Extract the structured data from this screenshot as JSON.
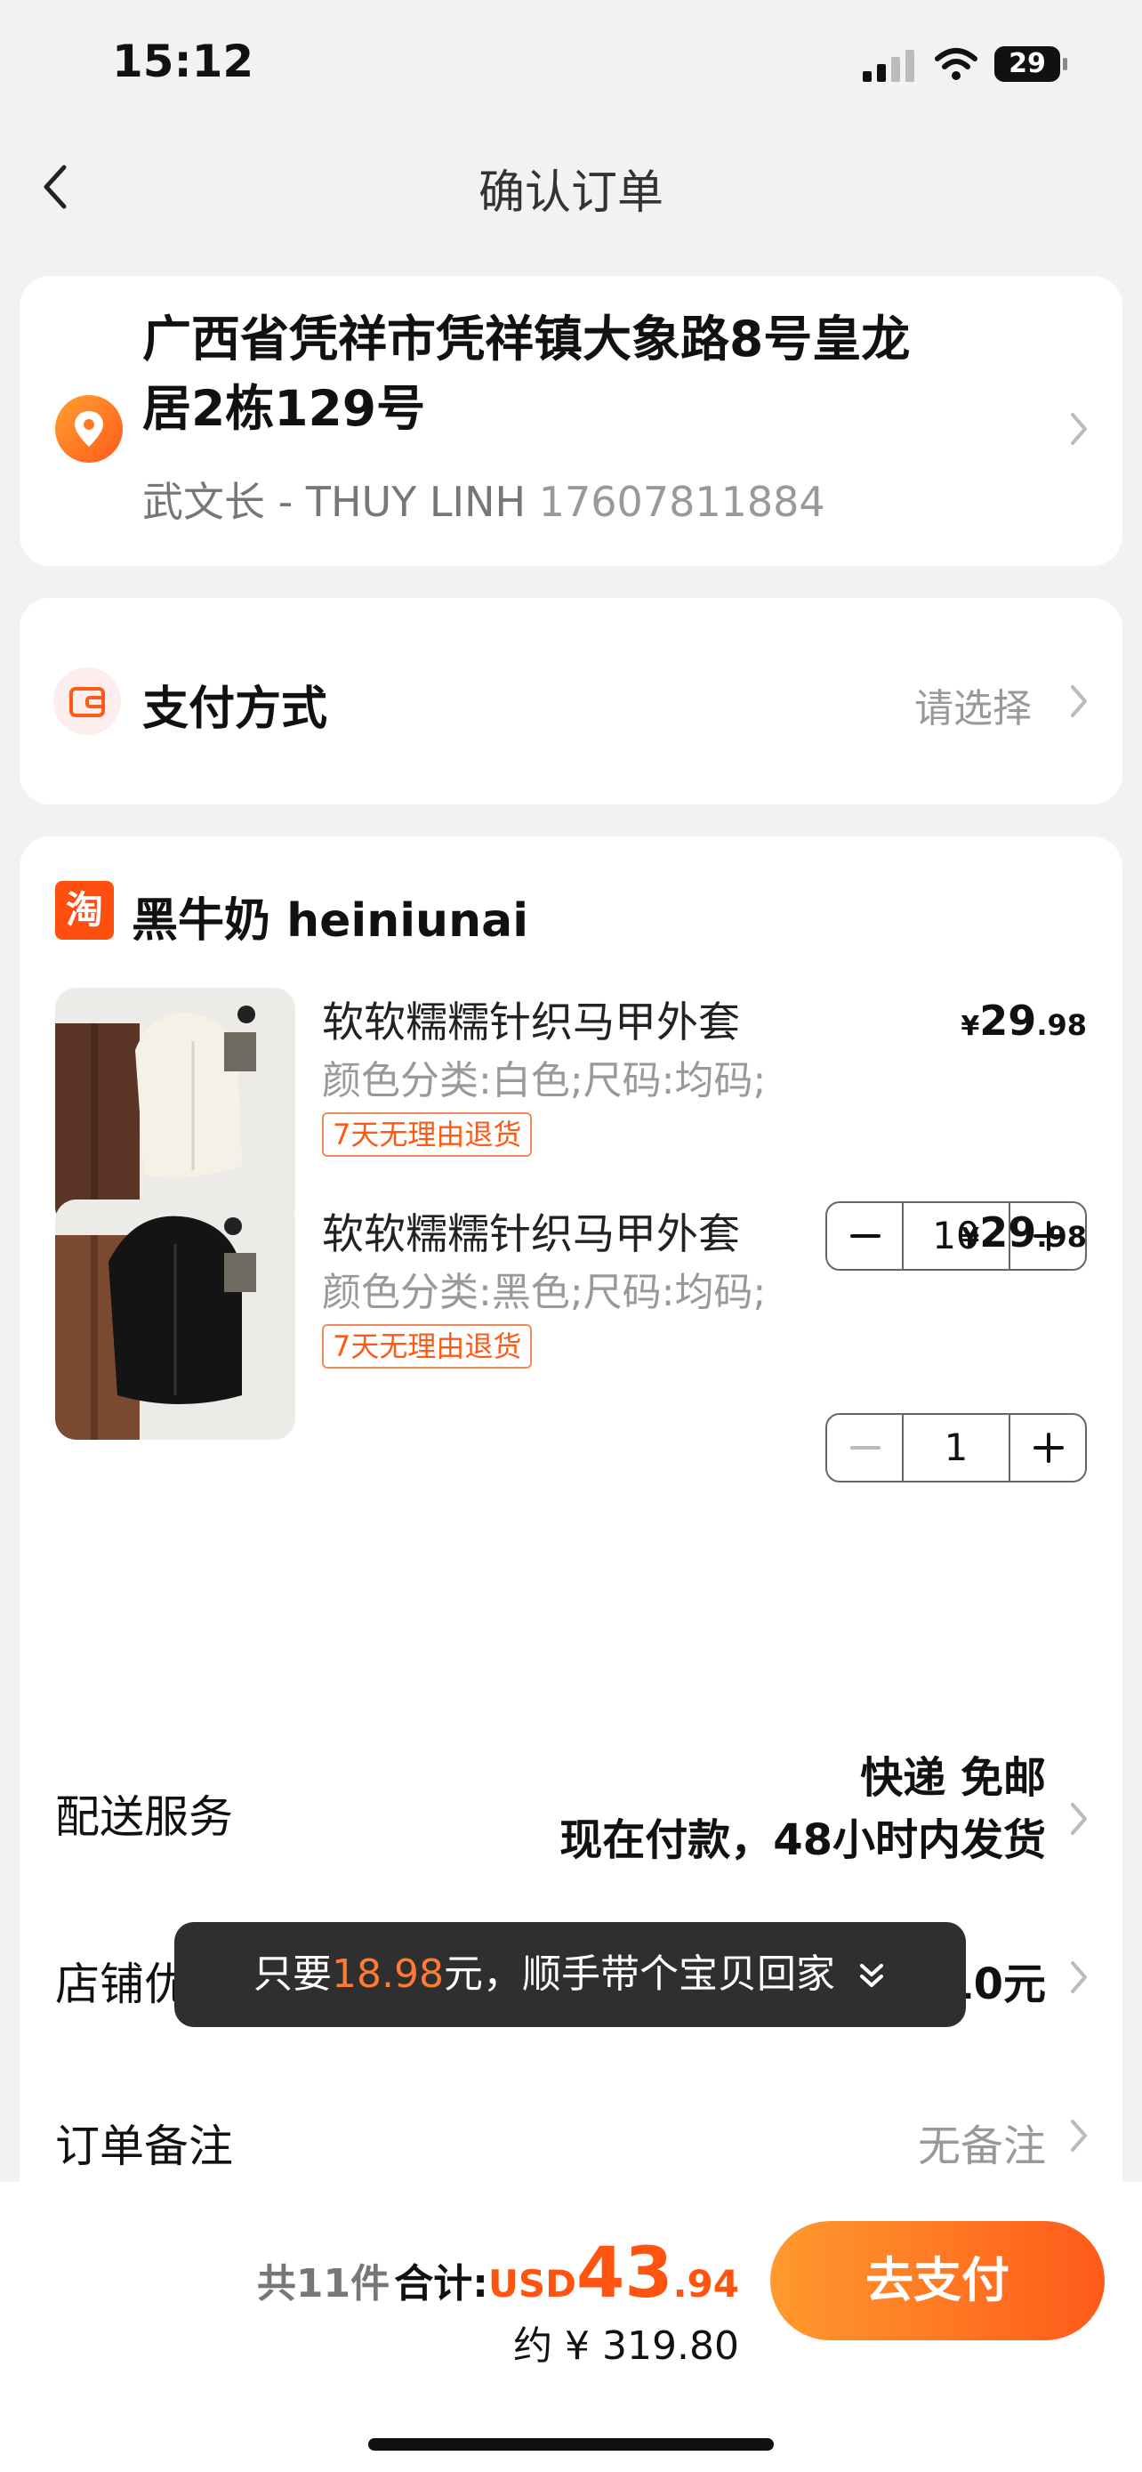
{
  "status_bar": {
    "time": "15:12",
    "battery": "29"
  },
  "nav": {
    "title": "确认订单"
  },
  "address": {
    "line1": "广西省凭祥市凭祥镇大象路8号皇龙",
    "line2": "居2栋129号",
    "contact_name": "武文长 - THUY LINH",
    "phone": "17607811884"
  },
  "payment": {
    "label": "支付方式",
    "value": "请选择"
  },
  "shop": {
    "logo_text": "淘",
    "name": "黑牛奶 heiniunai"
  },
  "products": [
    {
      "title": "软软糯糯针织马甲外套",
      "spec": "颜色分类:白色;尺码:均码;",
      "tag": "7天无理由退货",
      "price_currency": "¥",
      "price_int": "29",
      "price_dec": ".98",
      "qty": "10",
      "color": "white"
    },
    {
      "title": "软软糯糯针织马甲外套",
      "spec": "颜色分类:黑色;尺码:均码;",
      "tag": "7天无理由退货",
      "price_currency": "¥",
      "price_int": "29",
      "price_dec": ".98",
      "qty": "1",
      "color": "black"
    }
  ],
  "shipping": {
    "label": "配送服务",
    "value1": "快递 免邮",
    "value2": "现在付款，48小时内发货"
  },
  "coupon": {
    "label": "店铺优",
    "value": "10元"
  },
  "note": {
    "label": "订单备注",
    "value": "无备注"
  },
  "toast": {
    "prefix": "只要",
    "amount": "18.98",
    "suffix": "元，顺手带个宝贝回家"
  },
  "bottom": {
    "count": "共11件",
    "sum_label": "合计:",
    "currency": "USD",
    "amount_int": "43",
    "amount_dec": ".94",
    "approx": "约 ¥ 319.80",
    "pay_button": "去支付"
  },
  "colors": {
    "accent": "#ff5410",
    "pay_gradient_start": "#ff9a2e",
    "pay_gradient_end": "#ff5a1a"
  }
}
